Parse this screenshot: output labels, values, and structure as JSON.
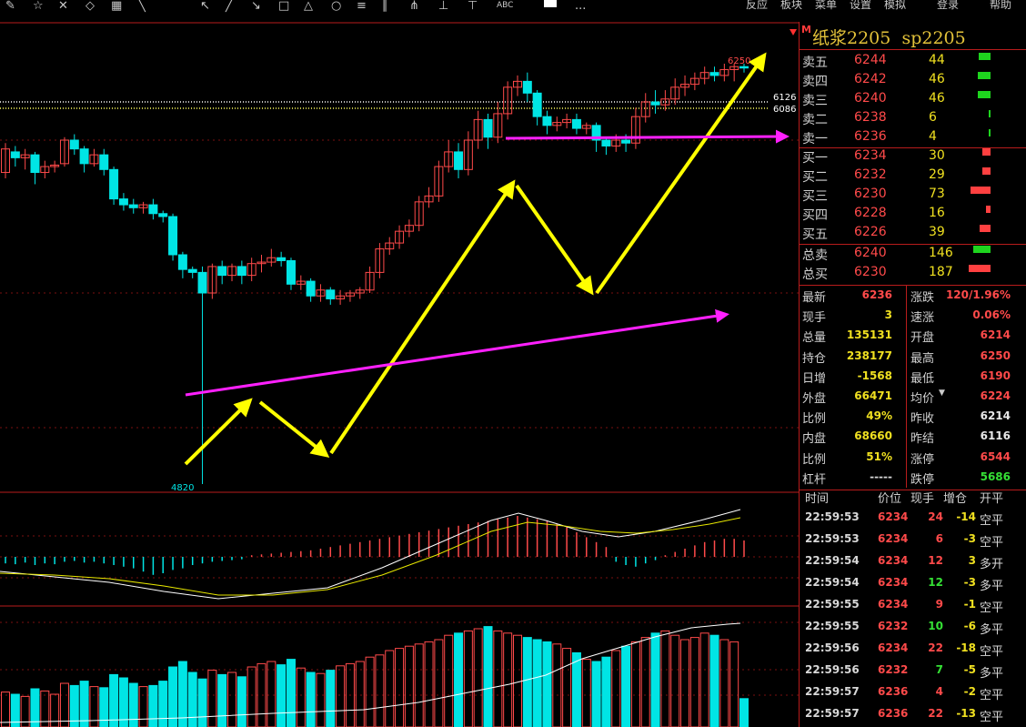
{
  "toolbar": {
    "icons": [
      "pencil-icon",
      "star-icon",
      "close-icon",
      "diamond-icon",
      "grid-icon",
      "slash-icon",
      "cursor-icon",
      "line-icon",
      "segment-icon",
      "rect-icon",
      "triangle-icon",
      "circle-icon",
      "fibonacci-icon",
      "parallel-icon",
      "pitchfork-icon",
      "up-arrow-icon",
      "down-arrow-icon",
      "text-abc-icon",
      "color-swatch-icon",
      "more-icon"
    ],
    "abc_label": "ABC",
    "more_label": "...",
    "right_menu": [
      "反应",
      "板块",
      "菜单",
      "设置",
      "模拟",
      "登录",
      "帮助"
    ]
  },
  "header": {
    "badge": "M",
    "title": "纸浆2205",
    "code": "sp2205"
  },
  "orderbook": {
    "asks": [
      {
        "label": "卖五",
        "price": "6244",
        "volume": "44",
        "bar": 0.55
      },
      {
        "label": "卖四",
        "price": "6242",
        "volume": "46",
        "bar": 0.57
      },
      {
        "label": "卖三",
        "price": "6240",
        "volume": "46",
        "bar": 0.57
      },
      {
        "label": "卖二",
        "price": "6238",
        "volume": "6",
        "bar": 0.08
      },
      {
        "label": "卖一",
        "price": "6236",
        "volume": "4",
        "bar": 0.06
      }
    ],
    "bids": [
      {
        "label": "买一",
        "price": "6234",
        "volume": "30",
        "bar": 0.37
      },
      {
        "label": "买二",
        "price": "6232",
        "volume": "29",
        "bar": 0.36
      },
      {
        "label": "买三",
        "price": "6230",
        "volume": "73",
        "bar": 0.9
      },
      {
        "label": "买四",
        "price": "6228",
        "volume": "16",
        "bar": 0.2
      },
      {
        "label": "买五",
        "price": "6226",
        "volume": "39",
        "bar": 0.48
      }
    ],
    "totals": [
      {
        "label": "总卖",
        "price": "6240",
        "volume": "146",
        "bar": 0.78
      },
      {
        "label": "总买",
        "price": "6230",
        "volume": "187",
        "bar": 1.0
      }
    ]
  },
  "stats": {
    "left": [
      {
        "label": "最新",
        "value": "6236",
        "color": "#ff4a4a"
      },
      {
        "label": "现手",
        "value": "3",
        "color": "#f0e020"
      },
      {
        "label": "总量",
        "value": "135131",
        "color": "#f0e020"
      },
      {
        "label": "持仓",
        "value": "238177",
        "color": "#f0e020"
      },
      {
        "label": "日增",
        "value": "-1568",
        "color": "#f0e020"
      },
      {
        "label": "外盘",
        "value": "66471",
        "color": "#f0e020"
      },
      {
        "label": "比例",
        "value": "49%",
        "color": "#f0e020"
      },
      {
        "label": "内盘",
        "value": "68660",
        "color": "#f0e020"
      },
      {
        "label": "比例",
        "value": "51%",
        "color": "#f0e020"
      },
      {
        "label": "杠杆",
        "value": "-----",
        "color": "#d8d8d8"
      }
    ],
    "right": [
      {
        "label": "涨跌",
        "value": "120/1.96%",
        "color": "#ff4a4a"
      },
      {
        "label": "速涨",
        "value": "0.06%",
        "color": "#ff4a4a"
      },
      {
        "label": "开盘",
        "value": "6214",
        "color": "#ff4a4a"
      },
      {
        "label": "最高",
        "value": "6250",
        "color": "#ff4a4a"
      },
      {
        "label": "最低",
        "value": "6190",
        "color": "#ff4a4a"
      },
      {
        "label": "均价",
        "value": "6224",
        "color": "#ff4a4a"
      },
      {
        "label": "昨收",
        "value": "6214",
        "color": "#e8e8e8"
      },
      {
        "label": "昨结",
        "value": "6116",
        "color": "#e8e8e8"
      },
      {
        "label": "涨停",
        "value": "6544",
        "color": "#ff4a4a"
      },
      {
        "label": "跌停",
        "value": "5686",
        "color": "#35e035"
      }
    ]
  },
  "trades": {
    "headers": [
      "时间",
      "价位",
      "现手",
      "增仓",
      "开平"
    ],
    "rows": [
      {
        "time": "22:59:53",
        "price": "6234",
        "qty": "24",
        "oi": "-14",
        "type": "空平",
        "qty_color": "#ff4a4a"
      },
      {
        "time": "22:59:53",
        "price": "6234",
        "qty": "6",
        "oi": "-3",
        "type": "空平",
        "qty_color": "#ff4a4a"
      },
      {
        "time": "22:59:54",
        "price": "6234",
        "qty": "12",
        "oi": "3",
        "type": "多开",
        "qty_color": "#ff4a4a"
      },
      {
        "time": "22:59:54",
        "price": "6234",
        "qty": "12",
        "oi": "-3",
        "type": "多平",
        "qty_color": "#35e035"
      },
      {
        "time": "22:59:55",
        "price": "6234",
        "qty": "9",
        "oi": "-1",
        "type": "空平",
        "qty_color": "#ff4a4a"
      },
      {
        "time": "22:59:55",
        "price": "6232",
        "qty": "10",
        "oi": "-6",
        "type": "多平",
        "qty_color": "#35e035"
      },
      {
        "time": "22:59:56",
        "price": "6234",
        "qty": "22",
        "oi": "-18",
        "type": "空平",
        "qty_color": "#ff4a4a"
      },
      {
        "time": "22:59:56",
        "price": "6232",
        "qty": "7",
        "oi": "-5",
        "type": "多平",
        "qty_color": "#35e035"
      },
      {
        "time": "22:59:57",
        "price": "6236",
        "qty": "4",
        "oi": "-2",
        "type": "空平",
        "qty_color": "#ff4a4a"
      },
      {
        "time": "22:59:57",
        "price": "6236",
        "qty": "22",
        "oi": "-13",
        "type": "空平",
        "qty_color": "#ff4a4a"
      }
    ]
  },
  "chart_data": {
    "type": "candlestick",
    "price_labels": {
      "high": "6250",
      "level1": "6126",
      "level2": "6086",
      "low": "4820"
    },
    "colors": {
      "up": "#ff4a4a",
      "down": "#00e5e5",
      "ma": "#ffffff",
      "ma_slow": "#e8e800",
      "arrow_yellow": "#ffff00",
      "arrow_magenta": "#ff20ff"
    },
    "candles": [
      [
        5880,
        5960,
        5860,
        5980
      ],
      [
        5950,
        5930,
        5900,
        5970
      ],
      [
        5930,
        5940,
        5890,
        5960
      ],
      [
        5940,
        5880,
        5840,
        5950
      ],
      [
        5880,
        5900,
        5860,
        5920
      ],
      [
        5900,
        5905,
        5880,
        5920
      ],
      [
        5910,
        5990,
        5900,
        6000
      ],
      [
        5990,
        5960,
        5940,
        6010
      ],
      [
        5960,
        5910,
        5880,
        5970
      ],
      [
        5910,
        5940,
        5900,
        5960
      ],
      [
        5940,
        5890,
        5870,
        5960
      ],
      [
        5890,
        5790,
        5770,
        5900
      ],
      [
        5790,
        5770,
        5750,
        5810
      ],
      [
        5770,
        5760,
        5740,
        5790
      ],
      [
        5760,
        5770,
        5740,
        5780
      ],
      [
        5770,
        5740,
        5720,
        5790
      ],
      [
        5740,
        5730,
        5710,
        5750
      ],
      [
        5730,
        5600,
        5580,
        5740
      ],
      [
        5600,
        5550,
        5520,
        5610
      ],
      [
        5550,
        5540,
        5520,
        5560
      ],
      [
        5540,
        5470,
        4820,
        5560
      ],
      [
        5470,
        5560,
        5450,
        5570
      ],
      [
        5560,
        5530,
        5500,
        5580
      ],
      [
        5530,
        5560,
        5510,
        5570
      ],
      [
        5560,
        5530,
        5500,
        5580
      ],
      [
        5530,
        5570,
        5510,
        5590
      ],
      [
        5570,
        5575,
        5540,
        5600
      ],
      [
        5575,
        5590,
        5560,
        5620
      ],
      [
        5590,
        5580,
        5560,
        5610
      ],
      [
        5580,
        5500,
        5480,
        5590
      ],
      [
        5500,
        5510,
        5480,
        5530
      ],
      [
        5510,
        5460,
        5440,
        5520
      ],
      [
        5460,
        5480,
        5440,
        5500
      ],
      [
        5480,
        5450,
        5430,
        5490
      ],
      [
        5450,
        5460,
        5430,
        5480
      ],
      [
        5460,
        5470,
        5440,
        5480
      ],
      [
        5470,
        5480,
        5450,
        5490
      ],
      [
        5480,
        5540,
        5470,
        5560
      ],
      [
        5540,
        5620,
        5520,
        5640
      ],
      [
        5620,
        5640,
        5600,
        5660
      ],
      [
        5640,
        5680,
        5620,
        5700
      ],
      [
        5680,
        5700,
        5660,
        5720
      ],
      [
        5700,
        5780,
        5680,
        5800
      ],
      [
        5780,
        5800,
        5760,
        5830
      ],
      [
        5800,
        5900,
        5780,
        5920
      ],
      [
        5900,
        5950,
        5880,
        5990
      ],
      [
        5950,
        5890,
        5860,
        5980
      ],
      [
        5890,
        5990,
        5870,
        6020
      ],
      [
        5990,
        6060,
        5960,
        6090
      ],
      [
        6060,
        6000,
        5960,
        6080
      ],
      [
        6000,
        6080,
        5980,
        6120
      ],
      [
        6080,
        6170,
        6060,
        6190
      ],
      [
        6170,
        6190,
        6140,
        6210
      ],
      [
        6190,
        6150,
        6120,
        6220
      ],
      [
        6150,
        6070,
        6040,
        6160
      ],
      [
        6070,
        6040,
        6010,
        6090
      ],
      [
        6040,
        6050,
        6020,
        6070
      ],
      [
        6050,
        6060,
        6030,
        6080
      ],
      [
        6060,
        6030,
        6010,
        6080
      ],
      [
        6030,
        6040,
        6010,
        6050
      ],
      [
        6040,
        5990,
        5950,
        6050
      ],
      [
        5990,
        5970,
        5940,
        6000
      ],
      [
        5970,
        5990,
        5950,
        6010
      ],
      [
        5990,
        5980,
        5950,
        6010
      ],
      [
        5980,
        6070,
        5960,
        6100
      ],
      [
        6070,
        6120,
        6050,
        6150
      ],
      [
        6120,
        6110,
        6080,
        6160
      ],
      [
        6110,
        6130,
        6090,
        6160
      ],
      [
        6130,
        6170,
        6110,
        6200
      ],
      [
        6170,
        6180,
        6140,
        6210
      ],
      [
        6180,
        6200,
        6160,
        6220
      ],
      [
        6200,
        6220,
        6180,
        6240
      ],
      [
        6220,
        6210,
        6190,
        6240
      ],
      [
        6210,
        6230,
        6190,
        6250
      ],
      [
        6230,
        6240,
        6190,
        6250
      ],
      [
        6240,
        6236,
        6220,
        6250
      ]
    ],
    "volumes": [
      32,
      30,
      28,
      35,
      33,
      30,
      40,
      38,
      42,
      37,
      36,
      48,
      45,
      40,
      37,
      38,
      42,
      55,
      60,
      50,
      44,
      52,
      48,
      50,
      46,
      55,
      58,
      60,
      57,
      62,
      54,
      50,
      49,
      52,
      56,
      58,
      60,
      64,
      66,
      70,
      72,
      74,
      76,
      78,
      80,
      84,
      86,
      88,
      90,
      92,
      88,
      86,
      84,
      82,
      80,
      78,
      76,
      72,
      68,
      62,
      60,
      64,
      70,
      74,
      78,
      82,
      86,
      88,
      84,
      80,
      82,
      86,
      84,
      80,
      78,
      26
    ],
    "macd_hist": [
      -8,
      -9,
      -7,
      -10,
      -8,
      -9,
      -6,
      -5,
      -7,
      -6,
      -8,
      -10,
      -12,
      -14,
      -18,
      -22,
      -20,
      -16,
      -14,
      -10,
      -8,
      -6,
      -5,
      -4,
      -3,
      2,
      3,
      4,
      5,
      6,
      7,
      8,
      10,
      12,
      14,
      16,
      18,
      20,
      22,
      24,
      26,
      28,
      30,
      32,
      34,
      36,
      38,
      40,
      42,
      44,
      46,
      48,
      50,
      48,
      46,
      44,
      40,
      36,
      30,
      24,
      18,
      12,
      -6,
      -10,
      -12,
      -8,
      -4,
      2,
      6,
      10,
      14,
      18,
      20,
      22,
      22,
      20
    ],
    "x_label": "",
    "y_label": ""
  }
}
